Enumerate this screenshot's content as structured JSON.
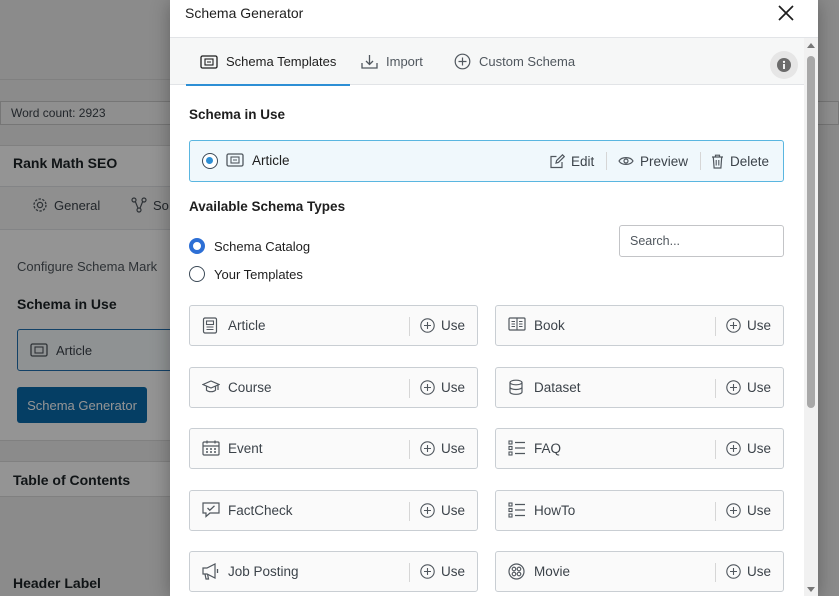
{
  "background": {
    "word_count": "Word count: 2923",
    "panel_title": "Rank Math SEO",
    "tabs": [
      "General",
      "So"
    ],
    "description": "Configure Schema Mark",
    "schema_in_use_label": "Schema in Use",
    "schema_in_use_item": "Article",
    "generator_button": "Schema Generator",
    "toc_title": "Table of Contents",
    "header_label": "Header Label"
  },
  "modal": {
    "title": "Schema Generator",
    "tabs": [
      {
        "label": "Schema Templates",
        "icon": "schema-icon",
        "active": true
      },
      {
        "label": "Import",
        "icon": "import-icon",
        "active": false
      },
      {
        "label": "Custom Schema",
        "icon": "plus-circle-icon",
        "active": false
      }
    ],
    "in_use": {
      "heading": "Schema in Use",
      "name": "Article",
      "edit_label": "Edit",
      "preview_label": "Preview",
      "delete_label": "Delete"
    },
    "available": {
      "heading": "Available Schema Types",
      "options": [
        {
          "label": "Schema Catalog",
          "checked": true
        },
        {
          "label": "Your Templates",
          "checked": false
        }
      ],
      "search_placeholder": "Search..."
    },
    "use_label": "Use",
    "schemas": [
      {
        "name": "Article",
        "icon": "article-icon"
      },
      {
        "name": "Book",
        "icon": "book-icon"
      },
      {
        "name": "Course",
        "icon": "course-icon"
      },
      {
        "name": "Dataset",
        "icon": "dataset-icon"
      },
      {
        "name": "Event",
        "icon": "calendar-icon"
      },
      {
        "name": "FAQ",
        "icon": "list-icon"
      },
      {
        "name": "FactCheck",
        "icon": "factcheck-icon"
      },
      {
        "name": "HowTo",
        "icon": "list-icon"
      },
      {
        "name": "Job Posting",
        "icon": "megaphone-icon"
      },
      {
        "name": "Movie",
        "icon": "film-icon"
      }
    ]
  },
  "colors": {
    "accent": "#2d8fd5",
    "primary_button": "#0a6bad",
    "in_use_border": "#5ab6e0"
  }
}
